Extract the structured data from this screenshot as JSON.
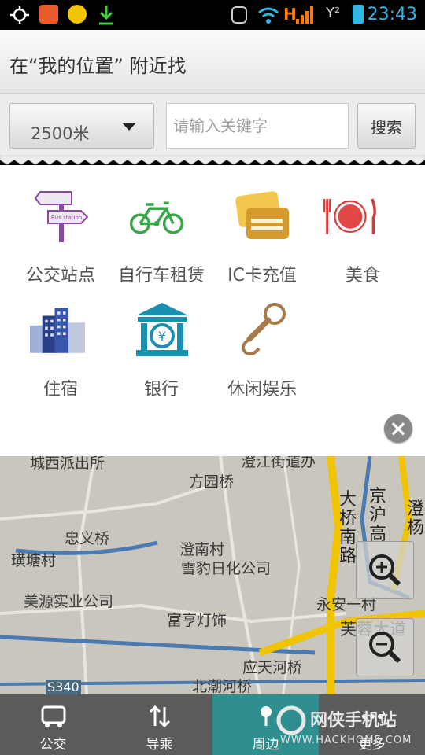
{
  "status_bar": {
    "time": "23:43"
  },
  "header": {
    "title": "在“我的位置” 附近找"
  },
  "search": {
    "distance": "2500米",
    "keyword_placeholder": "请输入关键字",
    "button": "搜索"
  },
  "categories": [
    {
      "label": "公交站点",
      "icon": "bus-station-sign-icon",
      "sign_text": "Bus station"
    },
    {
      "label": "自行车租赁",
      "icon": "bicycle-icon"
    },
    {
      "label": "IC卡充值",
      "icon": "ic-card-icon"
    },
    {
      "label": "美食",
      "icon": "fork-plate-knife-icon"
    },
    {
      "label": "住宿",
      "icon": "hotel-building-icon"
    },
    {
      "label": "银行",
      "icon": "bank-icon"
    },
    {
      "label": "休闲娱乐",
      "icon": "microphone-icon"
    }
  ],
  "map": {
    "labels": [
      "城西派出所",
      "澄江街道办",
      "方园桥",
      "忠义桥",
      "璜塘村",
      "澄南村",
      "雪豹日化公司",
      "美源实业公司",
      "富亨灯饰",
      "永安一村",
      "芙蓉大道",
      "应天河桥",
      "北潮河桥",
      "S340"
    ],
    "vertical_labels": [
      "大桥南路",
      "京沪高",
      "澄杨"
    ]
  },
  "bottom_nav": {
    "tabs": [
      {
        "label": "公交",
        "icon": "bus-icon"
      },
      {
        "label": "导乘",
        "icon": "transfer-arrows-icon"
      },
      {
        "label": "周边",
        "icon": "nearby-pin-icon"
      },
      {
        "label": "更多",
        "icon": "more-icon"
      }
    ]
  },
  "watermark": {
    "text": "网侠手机站",
    "url": "WWW.HACKHOME.COM"
  },
  "colors": {
    "accent_teal": "#2f8f8f",
    "time_blue": "#33b5e5",
    "road_yellow": "#f0c400"
  }
}
